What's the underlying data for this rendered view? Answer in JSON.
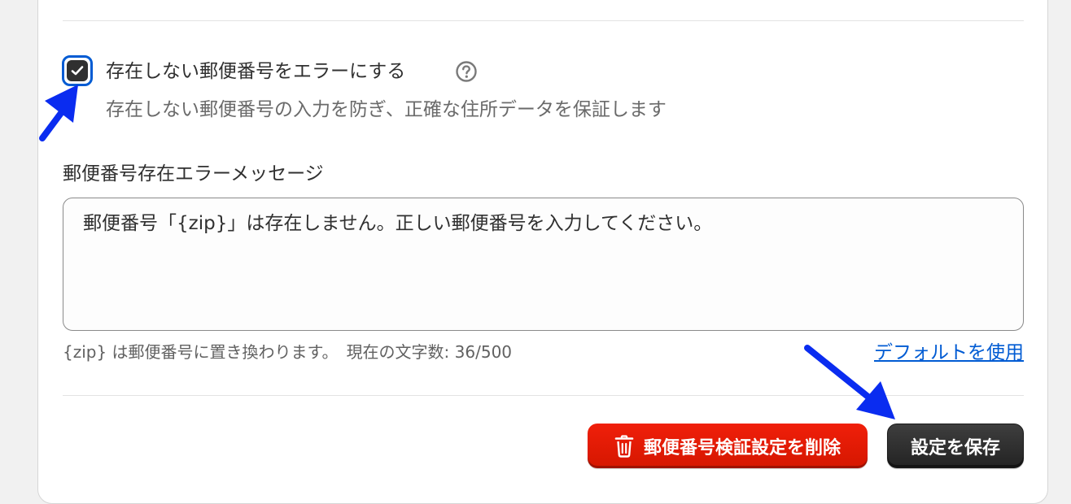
{
  "zip_validation": {
    "error_toggle": {
      "label": "存在しない郵便番号をエラーにする",
      "help_text": "存在しない郵便番号の入力を防ぎ、正確な住所データを保証します",
      "checked": true
    },
    "message_field": {
      "label": "郵便番号存在エラーメッセージ",
      "value": "郵便番号「{zip}」は存在しません。正しい郵便番号を入力してください。",
      "hint": "{zip} は郵便番号に置き換わります。",
      "char_count": "現在の文字数: 36/500",
      "use_default_link": "デフォルトを使用"
    },
    "actions": {
      "delete_label": "郵便番号検証設定を削除",
      "save_label": "設定を保存"
    }
  },
  "icons": {
    "checkbox": "checkmark-icon",
    "help": "question-circle-icon",
    "delete": "trash-icon"
  },
  "colors": {
    "focus_ring": "#005bd3",
    "critical": "#e51c00",
    "primary": "#303030",
    "link": "#005bd3",
    "annotation_arrow": "#0a2cf0"
  }
}
